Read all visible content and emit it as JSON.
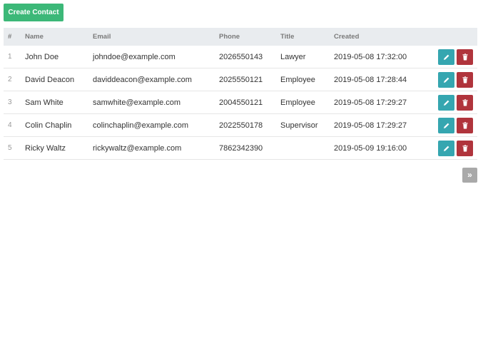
{
  "toolbar": {
    "create_label": "Create Contact"
  },
  "table": {
    "columns": [
      "#",
      "Name",
      "Email",
      "Phone",
      "Title",
      "Created"
    ],
    "rows": [
      {
        "num": "1",
        "name": "John Doe",
        "email": "johndoe@example.com",
        "phone": "2026550143",
        "title": "Lawyer",
        "created": "2019-05-08 17:32:00"
      },
      {
        "num": "2",
        "name": "David Deacon",
        "email": "daviddeacon@example.com",
        "phone": "2025550121",
        "title": "Employee",
        "created": "2019-05-08 17:28:44"
      },
      {
        "num": "3",
        "name": "Sam White",
        "email": "samwhite@example.com",
        "phone": "2004550121",
        "title": "Employee",
        "created": "2019-05-08 17:29:27"
      },
      {
        "num": "4",
        "name": "Colin Chaplin",
        "email": "colinchaplin@example.com",
        "phone": "2022550178",
        "title": "Supervisor",
        "created": "2019-05-08 17:29:27"
      },
      {
        "num": "5",
        "name": "Ricky Waltz",
        "email": "rickywaltz@example.com",
        "phone": "7862342390",
        "title": "",
        "created": "2019-05-09 19:16:00"
      }
    ]
  },
  "pagination": {
    "next_label": "»"
  },
  "icons": {
    "edit": "pencil-icon",
    "delete": "trash-icon"
  },
  "colors": {
    "create_button": "#3cb878",
    "edit_button": "#35a6b0",
    "delete_button": "#b0343c",
    "header_bg": "#e9ecef",
    "pagination_button": "#a9a9a9"
  }
}
